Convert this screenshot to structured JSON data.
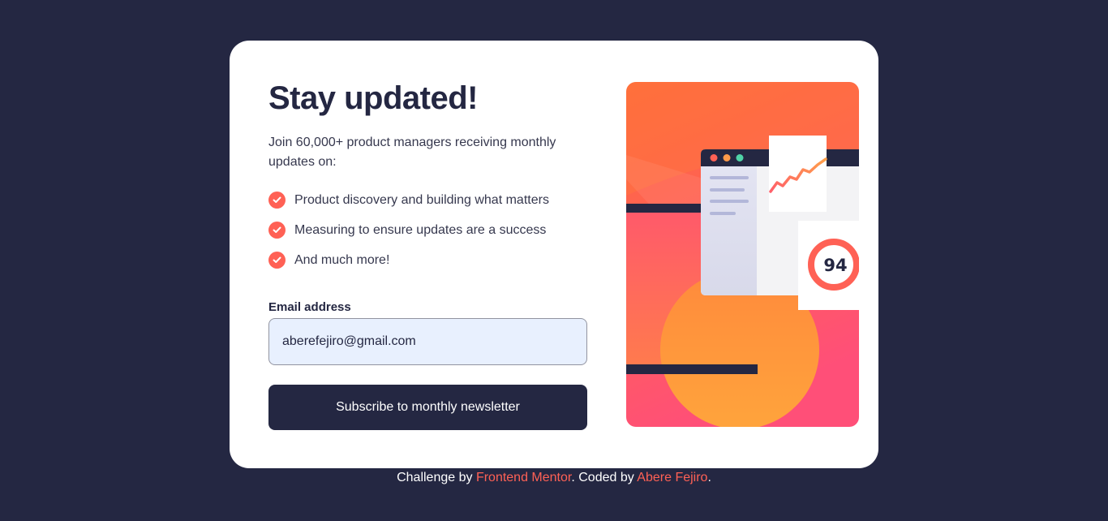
{
  "card": {
    "title": "Stay updated!",
    "intro": "Join 60,000+ product managers receiving monthly updates on:",
    "benefits": [
      "Product discovery and building what matters",
      "Measuring to ensure updates are a success",
      "And much more!"
    ],
    "email_label": "Email address",
    "email_value": "aberefejiro@gmail.com",
    "submit_label": "Subscribe to monthly newsletter",
    "score": "94"
  },
  "footer": {
    "prefix": "Challenge by ",
    "link1": "Frontend Mentor",
    "middle": ". Coded by ",
    "link2": "Abere Fejiro",
    "suffix": "."
  },
  "colors": {
    "background": "#242742",
    "accent": "#ff6155",
    "input_fill": "#e8f0fe"
  }
}
